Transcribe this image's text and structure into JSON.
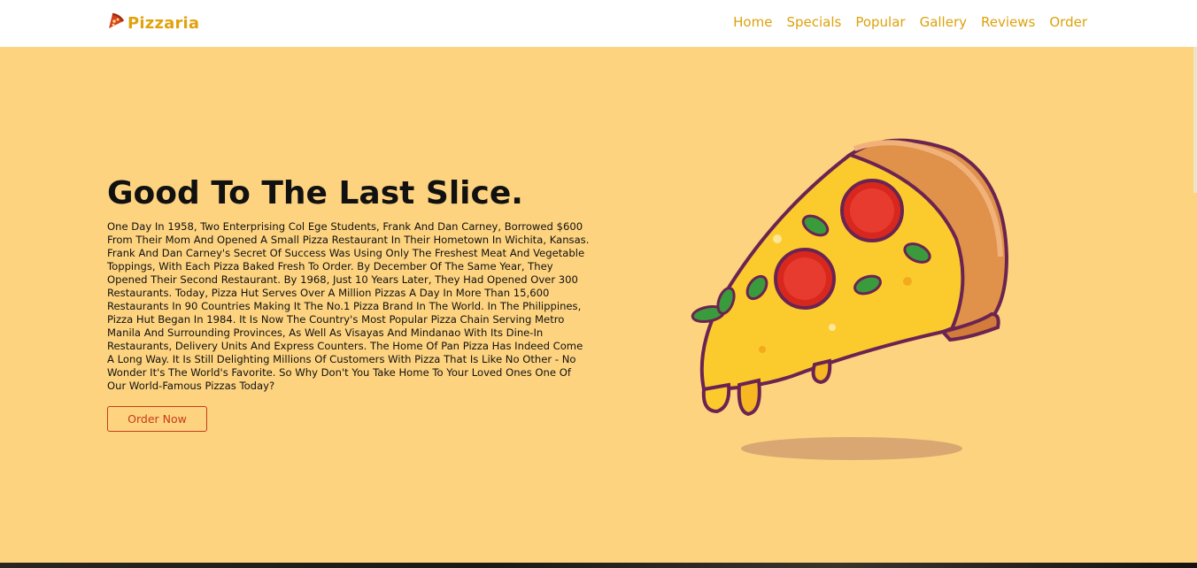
{
  "navbar": {
    "brand_name": "Pizzaria",
    "brand_icon": "pizza-slice-icon",
    "links": [
      "Home",
      "Specials",
      "Popular",
      "Gallery",
      "Reviews",
      "Order"
    ]
  },
  "hero": {
    "title": "Good To The Last Slice.",
    "description": "One Day In 1958, Two Enterprising Col Ege Students, Frank And Dan Carney, Borrowed $600 From Their Mom And Opened A Small Pizza Restaurant In Their Hometown In Wichita, Kansas. Frank And Dan Carney's Secret Of Success Was Using Only The Freshest Meat And Vegetable Toppings, With Each Pizza Baked Fresh To Order. By December Of The Same Year, They Opened Their Second Restaurant. By 1968, Just 10 Years Later, They Had Opened Over 300 Restaurants. Today, Pizza Hut Serves Over A Million Pizzas A Day In More Than 15,600 Restaurants In 90 Countries Making It The No.1 Pizza Brand In The World. In The Philippines, Pizza Hut Began In 1984. It Is Now The Country's Most Popular Pizza Chain Serving Metro Manila And Surrounding Provinces, As Well As Visayas And Mindanao With Its Dine-In Restaurants, Delivery Units And Express Counters. The Home Of Pan Pizza Has Indeed Come A Long Way. It Is Still Delighting Millions Of Customers With Pizza That Is Like No Other - No Wonder It's The World's Favorite. So Why Don't You Take Home To Your Loved Ones One Of Our World-Famous Pizzas Today?",
    "cta_label": "Order Now",
    "image_icon": "pizza-slice-illustration"
  },
  "colors": {
    "background": "#fdd37f",
    "navbar": "#ffffff",
    "accent": "#e2a20e",
    "button": "#c43d1a",
    "text": "#111111"
  }
}
